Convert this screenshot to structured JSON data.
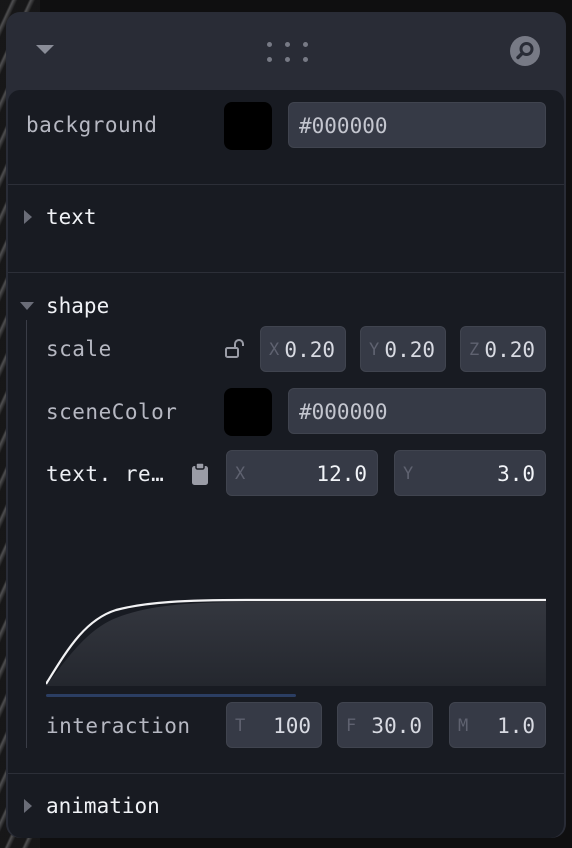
{
  "titlebar": {
    "collapse_icon": "chevron-down-icon",
    "drag_icon": "drag-handle-icon",
    "search_icon": "search-icon"
  },
  "root": {
    "background": {
      "label": "background",
      "value": "#000000",
      "color": "#000000"
    }
  },
  "folders": {
    "text": {
      "title": "text",
      "expanded": false
    },
    "shape": {
      "title": "shape",
      "expanded": true
    },
    "animation": {
      "title": "animation",
      "expanded": false
    }
  },
  "shape": {
    "scale": {
      "label": "scale",
      "x_axis": "X",
      "x": "0.20",
      "y_axis": "Y",
      "y": "0.20",
      "z_axis": "Z",
      "z": "0.20",
      "icon": "unlock-icon"
    },
    "sceneColor": {
      "label": "sceneColor",
      "value": "#000000",
      "color": "#000000"
    },
    "text_re": {
      "label": "text. re…",
      "x_axis": "X",
      "x": "12.0",
      "y_axis": "Y",
      "y": "3.0",
      "icon": "clipboard-icon"
    },
    "interaction": {
      "label": "interaction",
      "t_axis": "T",
      "t": "100",
      "f_axis": "F",
      "f": "30.0",
      "m_axis": "M",
      "m": "1.0",
      "progress": 0.5
    }
  },
  "colors": {
    "panel": "#292c36",
    "content": "#181b22",
    "field": "#363a46",
    "accent": "#2b3e63"
  }
}
